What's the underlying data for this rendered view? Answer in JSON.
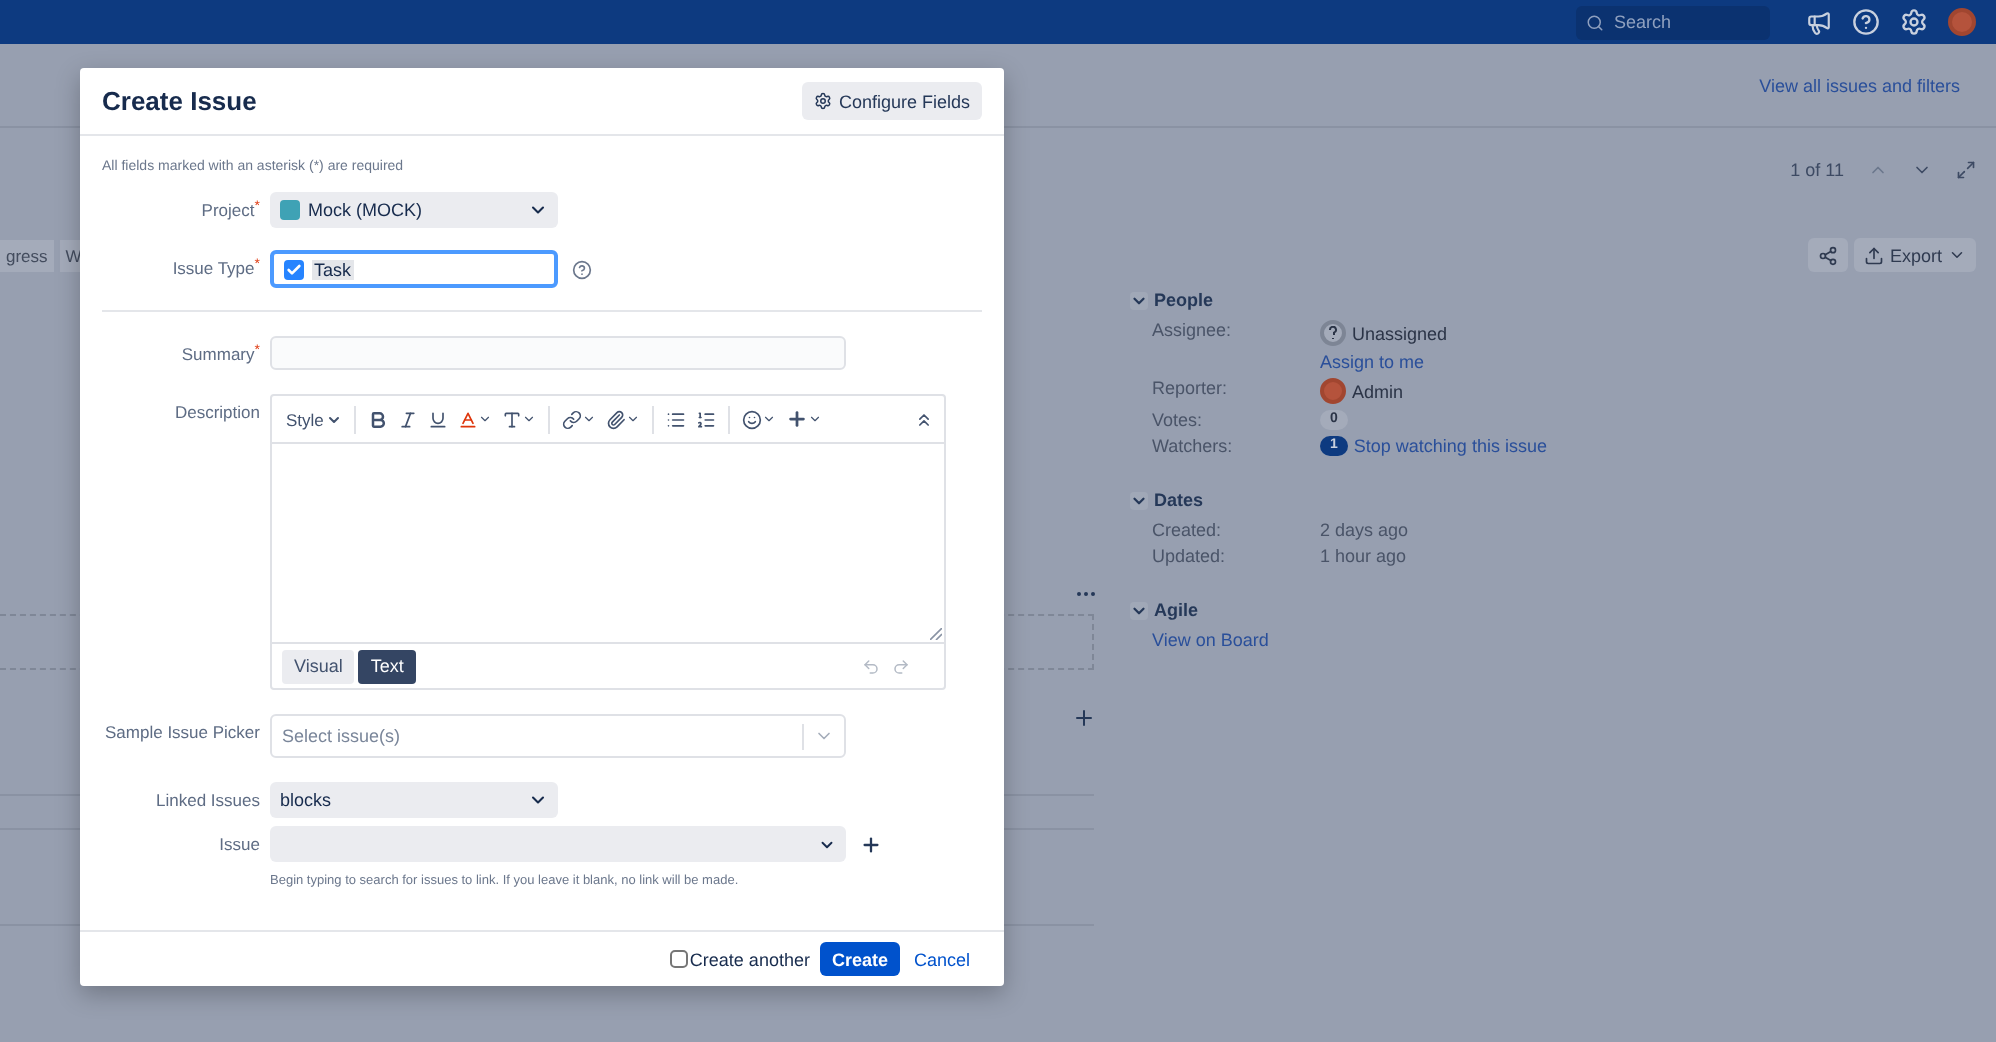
{
  "topnav": {
    "search": {
      "placeholder": "Search"
    }
  },
  "page": {
    "all_issues_link": "View all issues and filters",
    "pager": "1 of 11",
    "tabs": [
      "gress",
      "W"
    ],
    "export_button": "Export",
    "sidebar": [
      {
        "title": "People",
        "expanded": true,
        "fields": [
          {
            "kind": "unassigned",
            "label": "Assignee:",
            "value": "Unassigned",
            "link": "Assign to me"
          },
          {
            "kind": "person",
            "label": "Reporter:",
            "value": "Admin"
          },
          {
            "kind": "count",
            "label": "Votes:",
            "count": "0",
            "selected": false
          },
          {
            "kind": "count",
            "label": "Watchers:",
            "count": "1",
            "selected": true,
            "link": "Stop watching this issue"
          }
        ]
      },
      {
        "title": "Dates",
        "expanded": true,
        "fields": [
          {
            "kind": "text",
            "label": "Created:",
            "value": "2 days ago"
          },
          {
            "kind": "text",
            "label": "Updated:",
            "value": "1 hour ago"
          }
        ]
      },
      {
        "title": "Agile",
        "expanded": true,
        "fields": [
          {
            "kind": "link",
            "link": "View on Board"
          }
        ]
      }
    ]
  },
  "modal": {
    "title": "Create Issue",
    "configure_button": "Configure Fields",
    "required_note": "All fields marked with an asterisk (*) are required",
    "fields": [
      {
        "kind": "project_select",
        "label": "Project",
        "required_mark": "*",
        "value": "Mock (MOCK)"
      },
      {
        "kind": "issue_type",
        "label": "Issue Type",
        "required_mark": "*",
        "value": "Task",
        "focused": true
      },
      {
        "kind": "divider"
      },
      {
        "kind": "text",
        "label": "Summary",
        "required_mark": "*"
      },
      {
        "kind": "editor",
        "label": "Description",
        "style_label": "Style",
        "modes": [
          {
            "label": "Visual",
            "selected": false
          },
          {
            "label": "Text",
            "selected": true
          }
        ]
      },
      {
        "kind": "picker",
        "label": "Sample Issue Picker",
        "placeholder": "Select issue(s)"
      },
      {
        "kind": "select",
        "label": "Linked Issues",
        "value": "blocks"
      },
      {
        "kind": "issue_select",
        "label": "Issue",
        "hint": "Begin typing to search for issues to link. If you leave it blank, no link will be made."
      }
    ],
    "create_another": {
      "label": "Create another",
      "checked": false
    },
    "create_button": "Create",
    "cancel_link": "Cancel"
  }
}
